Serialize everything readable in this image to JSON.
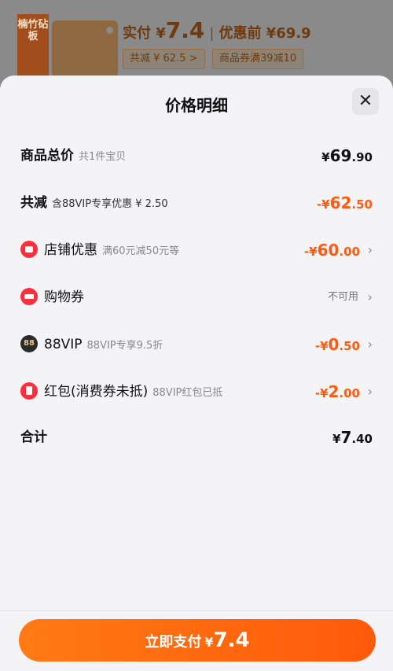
{
  "product": {
    "thumb_text": "楠竹砧板",
    "paid_label": "实付 ¥",
    "paid_amount": "7.4",
    "before_label": "优惠前 ¥69.9",
    "saved_chip": "共减 ¥ 62.5 >",
    "coupon_chip": "商品券满39减10"
  },
  "sheet": {
    "title": "价格明细",
    "close_icon": "close-icon"
  },
  "rows": [
    {
      "label": "商品总价",
      "sub": "共1件宝贝",
      "currency": "¥",
      "amount_int": "69",
      "amount_dec": ".90"
    },
    {
      "label": "共减",
      "sub": "含88VIP专享优惠 ¥ 2.50",
      "currency": "-¥",
      "amount_int": "62",
      "amount_dec": ".50"
    },
    {
      "label": "店铺优惠",
      "sub": "满60元减50元等",
      "currency": "-¥",
      "amount_int": "60",
      "amount_dec": ".00",
      "icon": "shop-icon"
    },
    {
      "label": "购物券",
      "sub": "",
      "status": "不可用",
      "icon": "ticket-icon"
    },
    {
      "label": "88VIP",
      "sub": "88VIP专享9.5折",
      "currency": "-¥",
      "amount_int": "0",
      "amount_dec": ".50",
      "icon_text": "88"
    },
    {
      "label": "红包(消费券未抵)",
      "sub": "88VIP红包已抵",
      "currency": "-¥",
      "amount_int": "2",
      "amount_dec": ".00",
      "icon": "red-packet-icon"
    },
    {
      "label": "合计",
      "sub": "",
      "currency": "¥",
      "amount_int": "7",
      "amount_dec": ".40"
    }
  ],
  "footer": {
    "pay_label": "立即支付",
    "currency": "¥",
    "pay_amount": "7.4"
  },
  "colors": {
    "accent": "#ff5a12",
    "danger": "#ff2e3d"
  }
}
